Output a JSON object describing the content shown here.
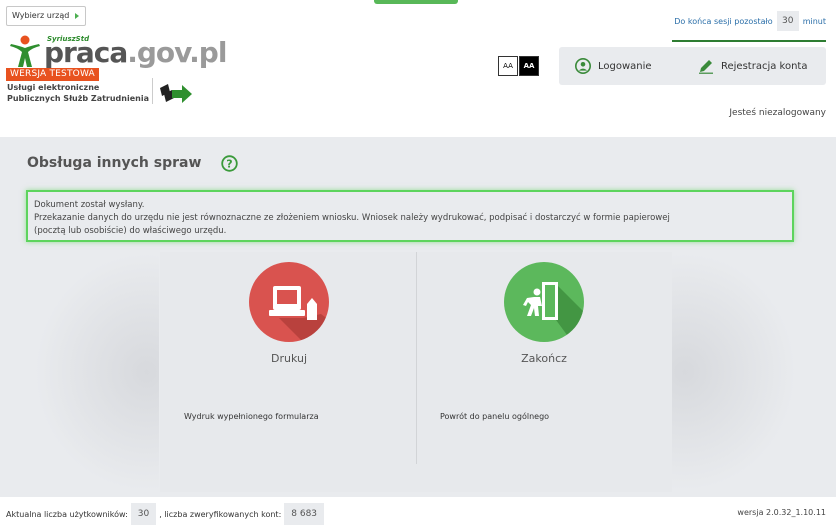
{
  "header": {
    "office_select": "Wybierz urząd",
    "session": {
      "prefix": "Do końca sesji pozostało",
      "minutes": "30",
      "suffix": "minut"
    },
    "logo": {
      "syriusz": "SyriuszStd",
      "praca": "praca",
      "gov": ".gov.pl",
      "testowa": "WERSJA TESTOWA",
      "line1": "Usługi elektroniczne",
      "line2": "Publicznych Służb Zatrudnienia"
    },
    "font_toggle": {
      "normal": "AA",
      "large": "AA"
    },
    "login_label": "Logowanie",
    "register_label": "Rejestracja konta",
    "status": "Jesteś niezalogowany"
  },
  "main": {
    "title": "Obsługa innych spraw",
    "alert": {
      "line1": "Dokument został wysłany.",
      "line2": "Przekazanie danych do urzędu nie jest równoznaczne ze złożeniem wniosku. Wniosek należy wydrukować, podpisać i dostarczyć w formie papierowej",
      "line3": "(pocztą lub osobiście) do właściwego urzędu."
    },
    "tiles": [
      {
        "label": "Drukuj",
        "description": "Wydruk wypełnionego formularza",
        "color": "#d9534f"
      },
      {
        "label": "Zakończ",
        "description": "Powrót do panelu ogólnego",
        "color": "#5cb85c"
      }
    ]
  },
  "footer": {
    "users_label": "Aktualna liczba użytkowników:",
    "users_count": "30",
    "verified_label": ", liczba zweryfikowanych kont:",
    "verified_count": "8 683",
    "version": "wersja 2.0.32_1.10.11"
  },
  "colors": {
    "accent_green": "#4caf50",
    "testowa_orange": "#e8521f",
    "alert_border": "#5dd45d"
  },
  "icons": [
    "chevron-right-icon",
    "user-icon",
    "pencil-icon",
    "help-icon",
    "printer-icon",
    "exit-door-icon",
    "arrow-logo-icon"
  ]
}
